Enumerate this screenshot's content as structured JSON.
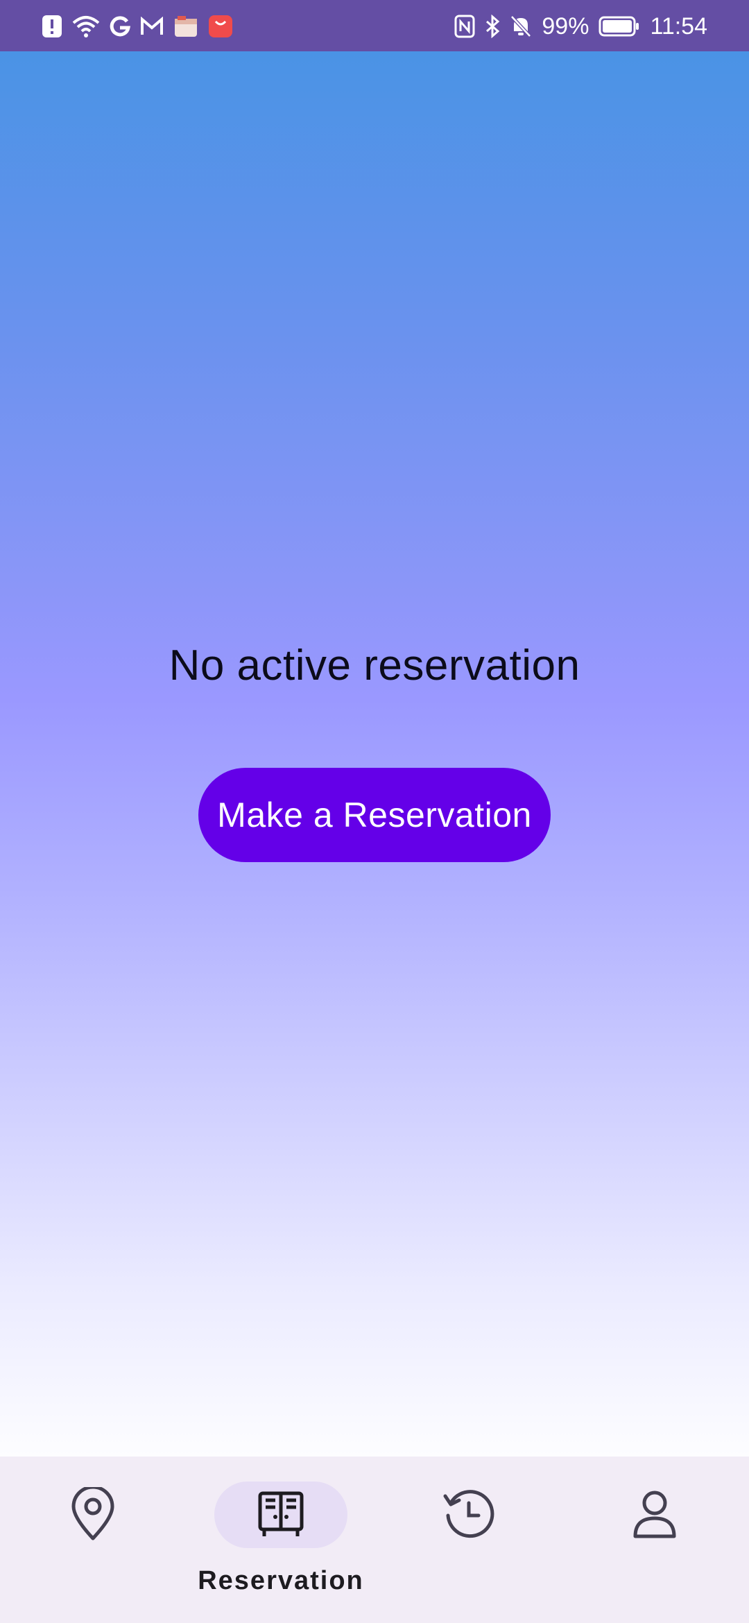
{
  "status_bar": {
    "battery_percent": "99%",
    "time": "11:54",
    "left_icons": [
      "alert-icon",
      "wifi-icon",
      "google-icon",
      "gmail-icon",
      "app-box-icon",
      "huawei-store-icon"
    ],
    "right_icons": [
      "nfc-icon",
      "bluetooth-icon",
      "bell-off-icon",
      "battery-icon"
    ]
  },
  "main": {
    "empty_message": "No active reservation",
    "reserve_button_label": "Make a Reservation"
  },
  "bottom_nav": {
    "items": [
      {
        "icon": "location-pin-icon",
        "label": "",
        "selected": false
      },
      {
        "icon": "locker-icon",
        "label": "Reservation",
        "selected": true
      },
      {
        "icon": "history-icon",
        "label": "",
        "selected": false
      },
      {
        "icon": "profile-icon",
        "label": "",
        "selected": false
      }
    ]
  },
  "colors": {
    "status_bar_bg": "#644ea4",
    "gradient_top": "#4a93e5",
    "gradient_mid": "#9a98ff",
    "gradient_bottom": "#fdfdff",
    "button_bg": "#6400e8",
    "nav_bg": "#f2ecf6",
    "nav_pill": "#e6ddf5"
  }
}
